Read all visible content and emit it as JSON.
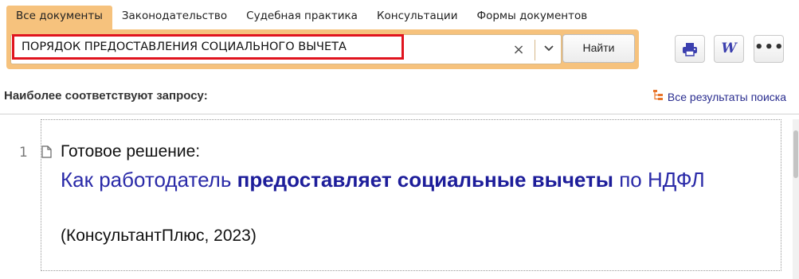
{
  "tabs": [
    {
      "label": "Все документы",
      "active": true
    },
    {
      "label": "Законодательство",
      "active": false
    },
    {
      "label": "Судебная практика",
      "active": false
    },
    {
      "label": "Консультации",
      "active": false
    },
    {
      "label": "Формы документов",
      "active": false
    }
  ],
  "search": {
    "value": "ПОРЯДОК ПРЕДОСТАВЛЕНИЯ СОЦИАЛЬНОГО ВЫЧЕТА",
    "clear_symbol": "×",
    "find_label": "Найти"
  },
  "toolbar": {
    "print_icon": "printer-icon",
    "word_icon": "word-icon",
    "word_letter": "W",
    "more_label": "•••"
  },
  "results": {
    "heading": "Наиболее соответствуют запросу:",
    "all_results_label": "Все результаты поиска",
    "items": [
      {
        "number": "1",
        "kind": "Готовое решение:",
        "title_before": "Как работодатель ",
        "title_bold": "предоставляет социальные вычеты",
        "title_after": " по НДФЛ",
        "source": "(КонсультантПлюс, 2023)"
      }
    ]
  },
  "colors": {
    "tab_active_bg": "#f6c27d",
    "highlight_border": "#e0141e",
    "link_color": "#2a2aa8"
  }
}
